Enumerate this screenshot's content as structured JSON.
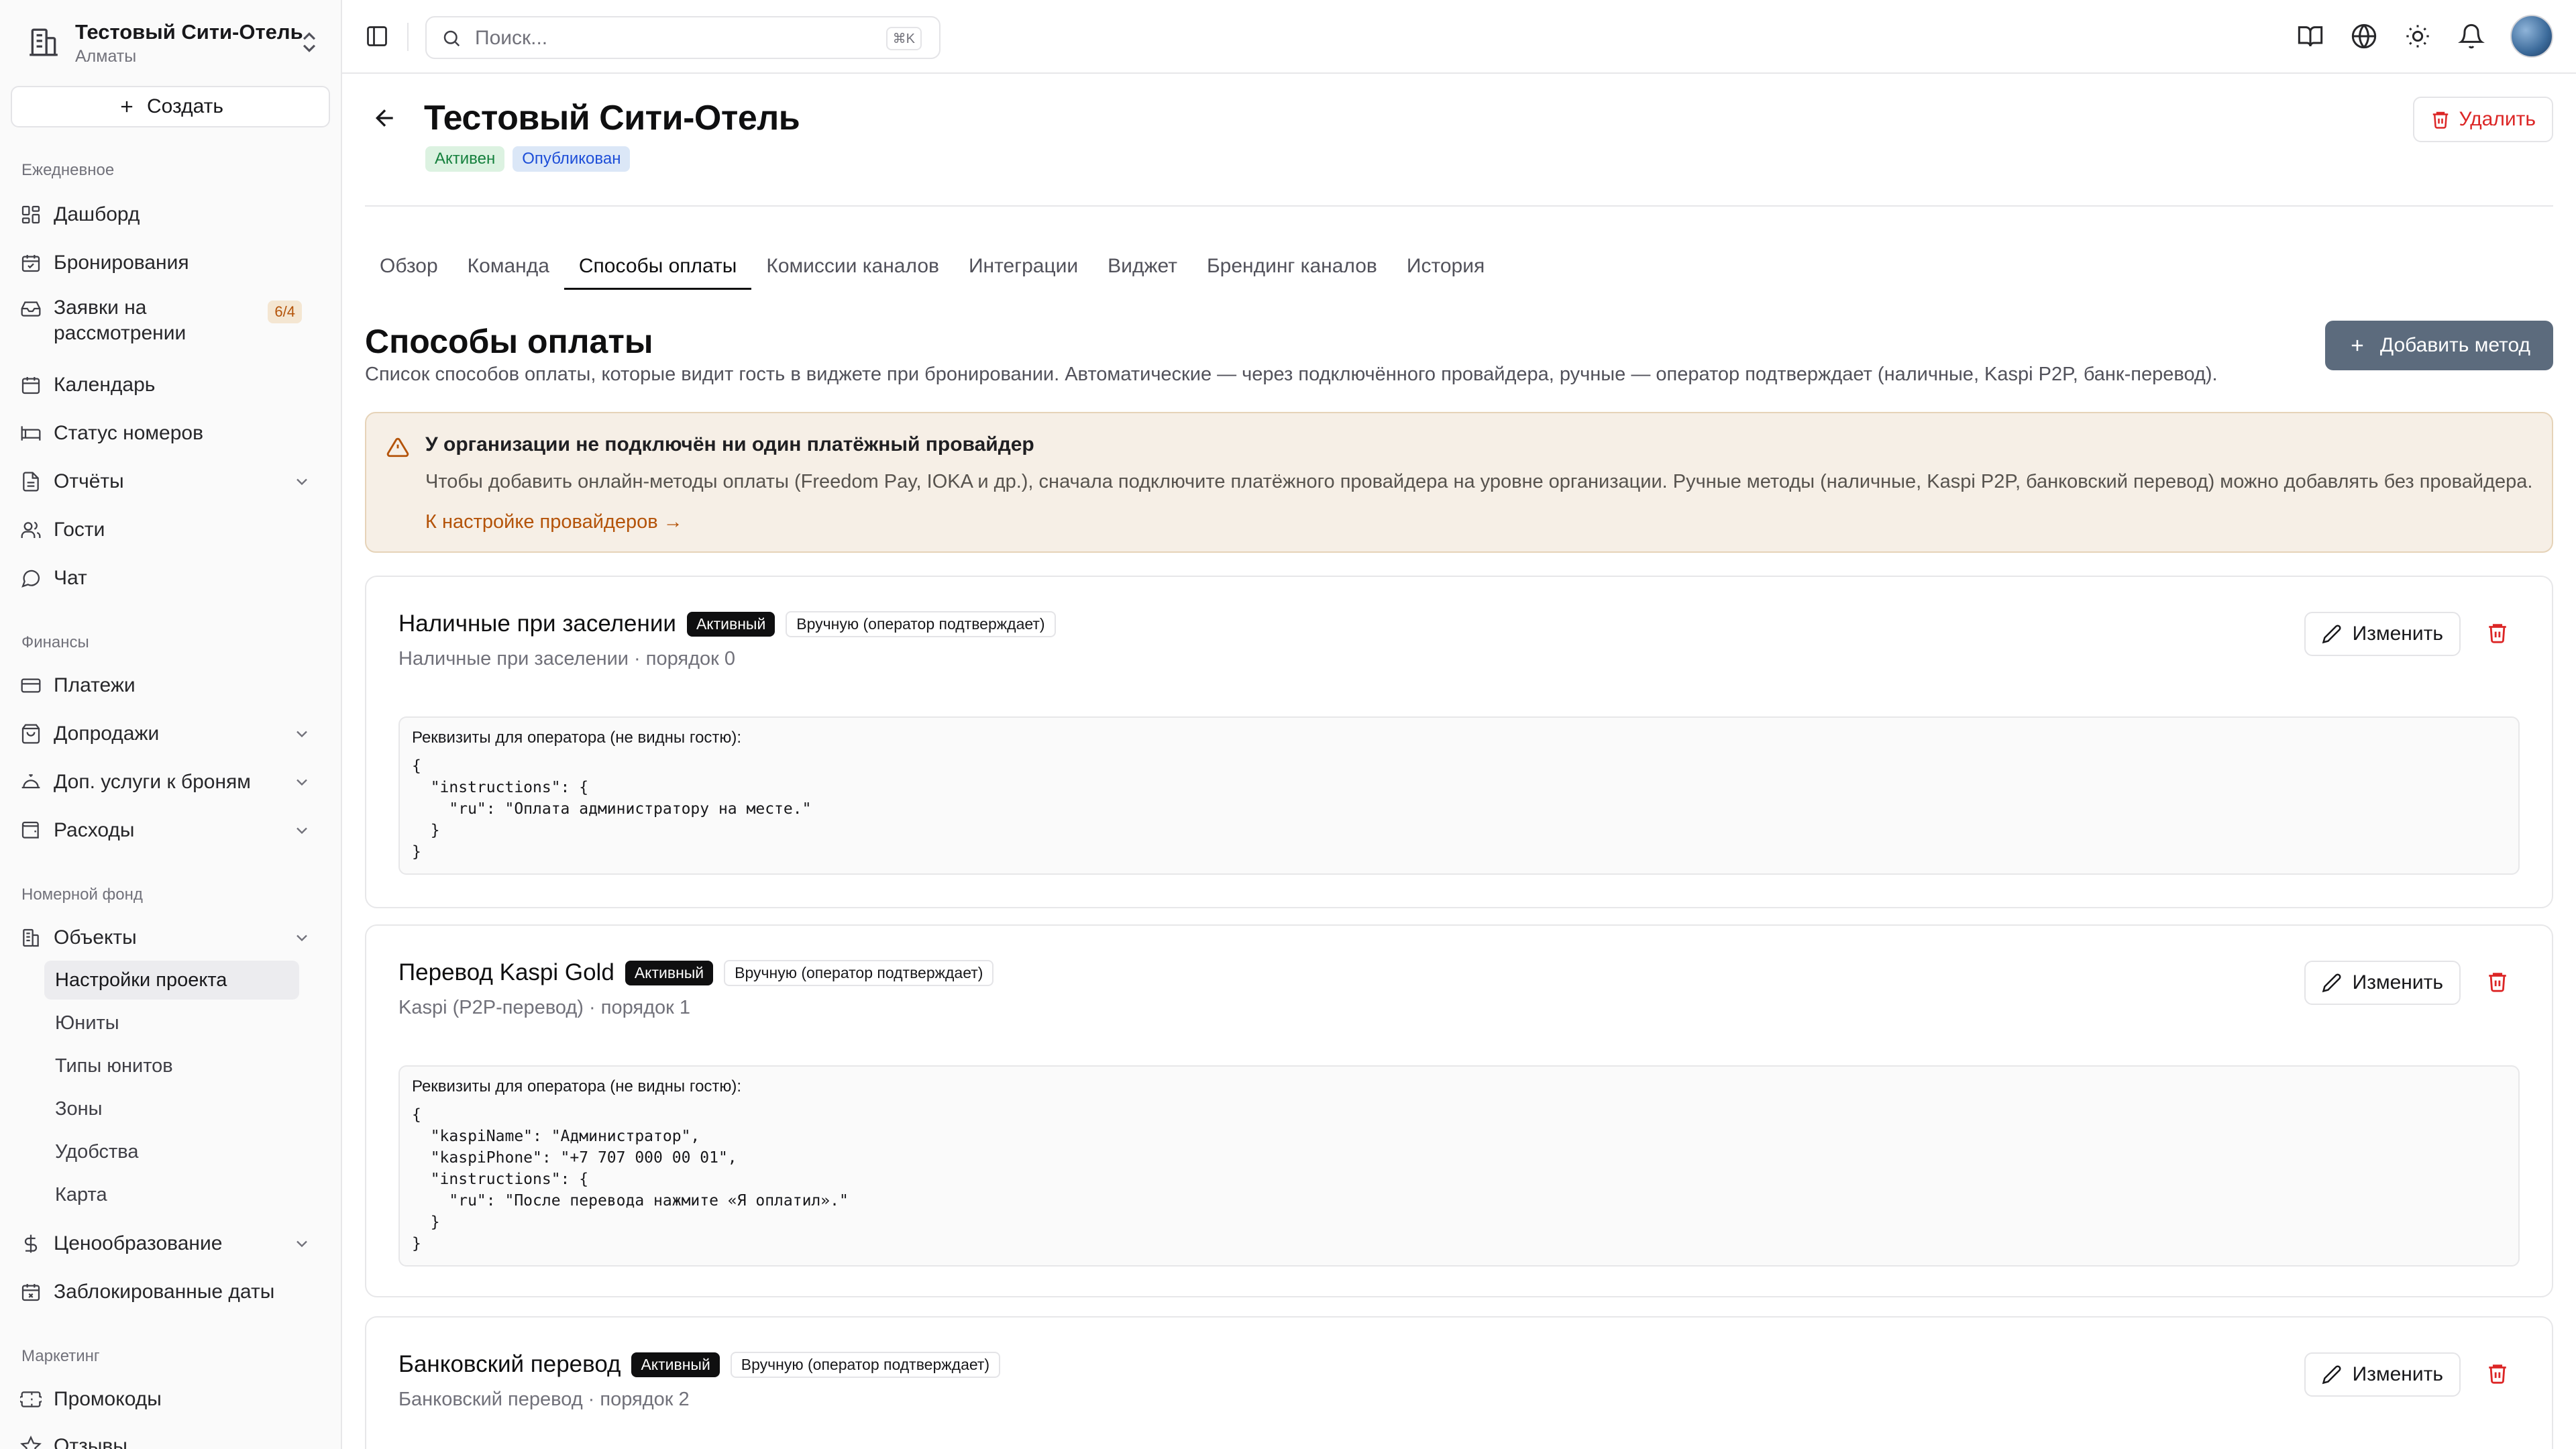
{
  "org": {
    "name": "Тестовый Сити-Отель",
    "city": "Алматы",
    "create_label": "Создать"
  },
  "sidebar": {
    "sections": [
      {
        "label": "Ежедневное"
      },
      {
        "label": "Финансы"
      },
      {
        "label": "Номерной фонд"
      },
      {
        "label": "Маркетинг"
      }
    ],
    "items": {
      "dashboard": "Дашборд",
      "bookings": "Бронирования",
      "requests": "Заявки на рассмотрении",
      "requests_badge": "6/4",
      "calendar": "Календарь",
      "room_status": "Статус номеров",
      "reports": "Отчёты",
      "guests": "Гости",
      "chat": "Чат",
      "payments": "Платежи",
      "upsales": "Допродажи",
      "extras": "Доп. услуги к броням",
      "expenses": "Расходы",
      "objects": "Объекты",
      "pricing": "Ценообразование",
      "blocked_dates": "Заблокированные даты",
      "promocodes": "Промокоды",
      "reviews": "Отзывы"
    },
    "sub_items": [
      "Настройки проекта",
      "Юниты",
      "Типы юнитов",
      "Зоны",
      "Удобства",
      "Карта"
    ]
  },
  "topbar": {
    "search_placeholder": "Поиск...",
    "shortcut": "⌘K"
  },
  "header": {
    "title": "Тестовый Сити-Отель",
    "status_active": "Активен",
    "status_published": "Опубликован",
    "delete_label": "Удалить"
  },
  "tabs": [
    "Обзор",
    "Команда",
    "Способы оплаты",
    "Комиссии каналов",
    "Интеграции",
    "Виджет",
    "Брендинг каналов",
    "История"
  ],
  "section": {
    "title": "Способы оплаты",
    "description": "Список способов оплаты, которые видит гость в виджете при бронировании. Автоматические — через подключённого провайдера, ручные — оператор подтверждает (наличные, Kaspi P2P, банк-перевод).",
    "add_label": "Добавить метод"
  },
  "alert": {
    "title": "У организации не подключён ни один платёжный провайдер",
    "text": "Чтобы добавить онлайн-методы оплаты (Freedom Pay, IOKA и др.), сначала подключите платёжного провайдера на уровне организации. Ручные методы (наличные, Kaspi P2P, банковский перевод) можно добавлять без провайдера.",
    "link": "К настройке провайдеров →"
  },
  "methods": [
    {
      "name": "Наличные при заселении",
      "status": "Активный",
      "mode": "Вручную (оператор подтверждает)",
      "subtitle": "Наличные при заселении · порядок 0",
      "edit_label": "Изменить",
      "details_caption": "Реквизиты для оператора (не видны гостю):",
      "details": "{\n  \"instructions\": {\n    \"ru\": \"Оплата администратору на месте.\"\n  }\n}"
    },
    {
      "name": "Перевод Kaspi Gold",
      "status": "Активный",
      "mode": "Вручную (оператор подтверждает)",
      "subtitle": "Kaspi (P2P-перевод) · порядок 1",
      "edit_label": "Изменить",
      "details_caption": "Реквизиты для оператора (не видны гостю):",
      "details": "{\n  \"kaspiName\": \"Администратор\",\n  \"kaspiPhone\": \"+7 707 000 00 01\",\n  \"instructions\": {\n    \"ru\": \"После перевода нажмите «Я оплатил».\"\n  }\n}"
    },
    {
      "name": "Банковский перевод",
      "status": "Активный",
      "mode": "Вручную (оператор подтверждает)",
      "subtitle": "Банковский перевод · порядок 2",
      "edit_label": "Изменить"
    }
  ]
}
